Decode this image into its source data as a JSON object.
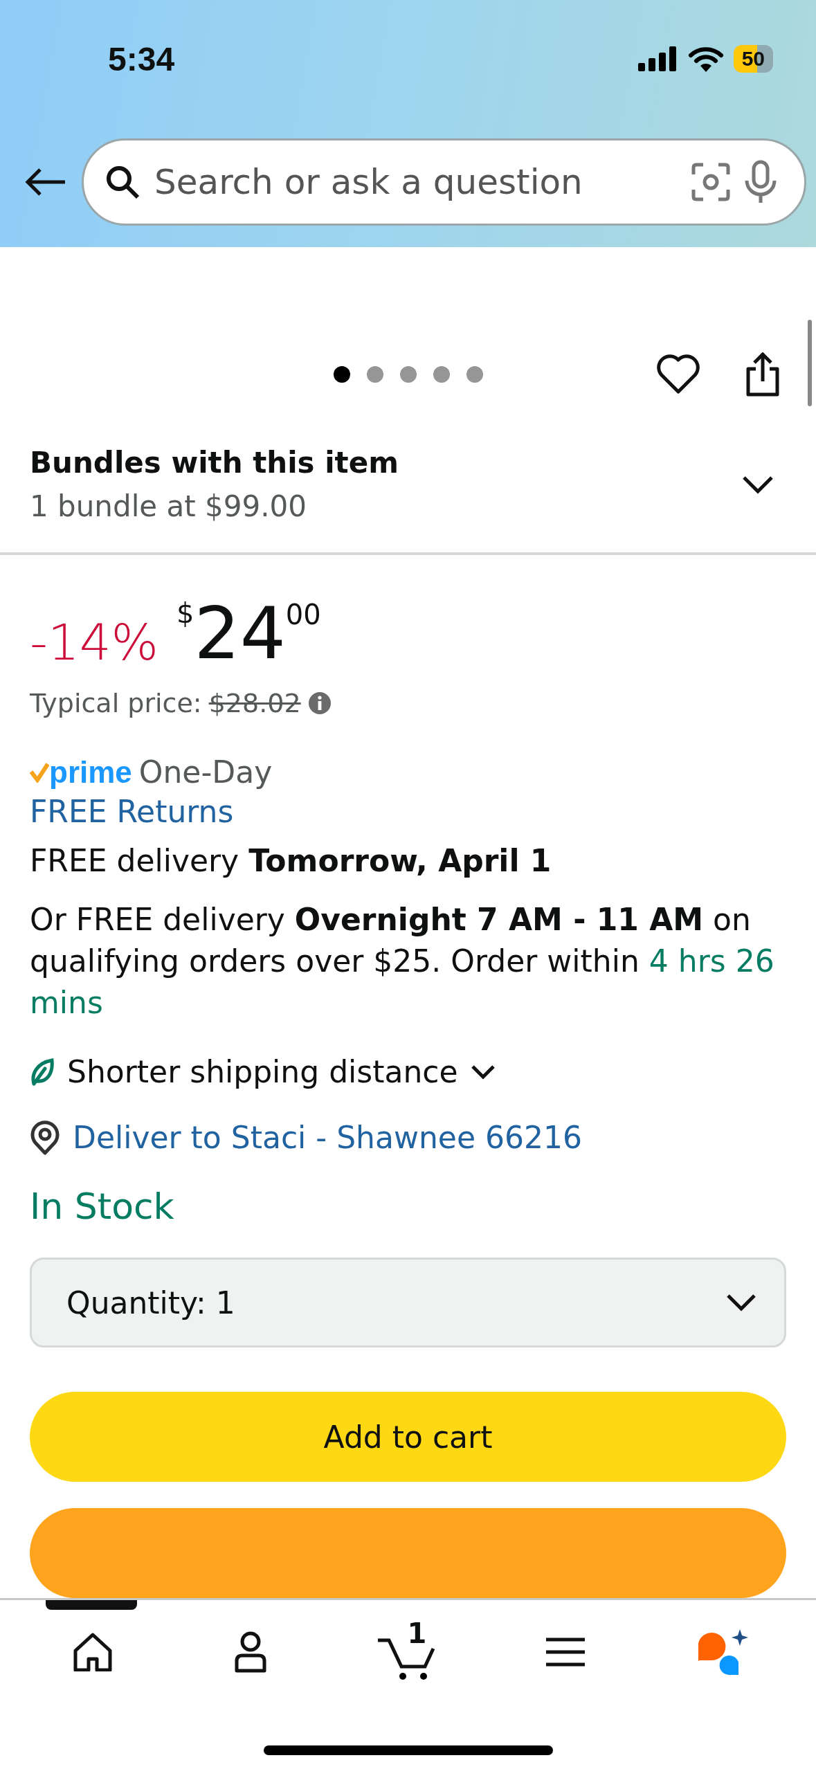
{
  "status_bar": {
    "time": "5:34",
    "battery": "50"
  },
  "search": {
    "placeholder": "Search or ask a question"
  },
  "carousel": {
    "dots": [
      {
        "selected": true
      },
      {
        "selected": false
      },
      {
        "selected": false
      },
      {
        "selected": false
      },
      {
        "selected": false
      }
    ]
  },
  "bundles": {
    "title": "Bundles with this item",
    "subtitle": "1 bundle at $99.00",
    "expanded": false
  },
  "price": {
    "discount": "-14%",
    "currency": "$",
    "whole": "24",
    "fraction": "00",
    "typical_label": "Typical price:",
    "typical_value": "$28.02"
  },
  "delivery": {
    "prime_badge": "prime",
    "prime_label": "One-Day",
    "returns": "FREE Returns",
    "primary": "FREE delivery **Tomorrow, April 1**",
    "secondary": "Or FREE delivery **Overnight 7 AM - 11 AM** on qualifying orders over $25. Order within ",
    "countdown": "4 hrs 26 mins",
    "shipping_note": "Shorter shipping distance",
    "deliver_to": "Deliver to Staci - Shawnee 66216"
  },
  "stock": "In Stock",
  "quantity": {
    "label": "Quantity:",
    "value": "1"
  },
  "buttons": [
    {
      "kind": "add",
      "label": "Add to cart"
    },
    {
      "kind": "buy"
    }
  ],
  "nav": [
    {
      "kind": "home",
      "selected": true
    },
    {
      "kind": "account",
      "selected": false
    },
    {
      "kind": "cart",
      "badge": "1",
      "selected": false
    },
    {
      "kind": "menu",
      "selected": false
    },
    {
      "kind": "assistant",
      "selected": false
    }
  ]
}
